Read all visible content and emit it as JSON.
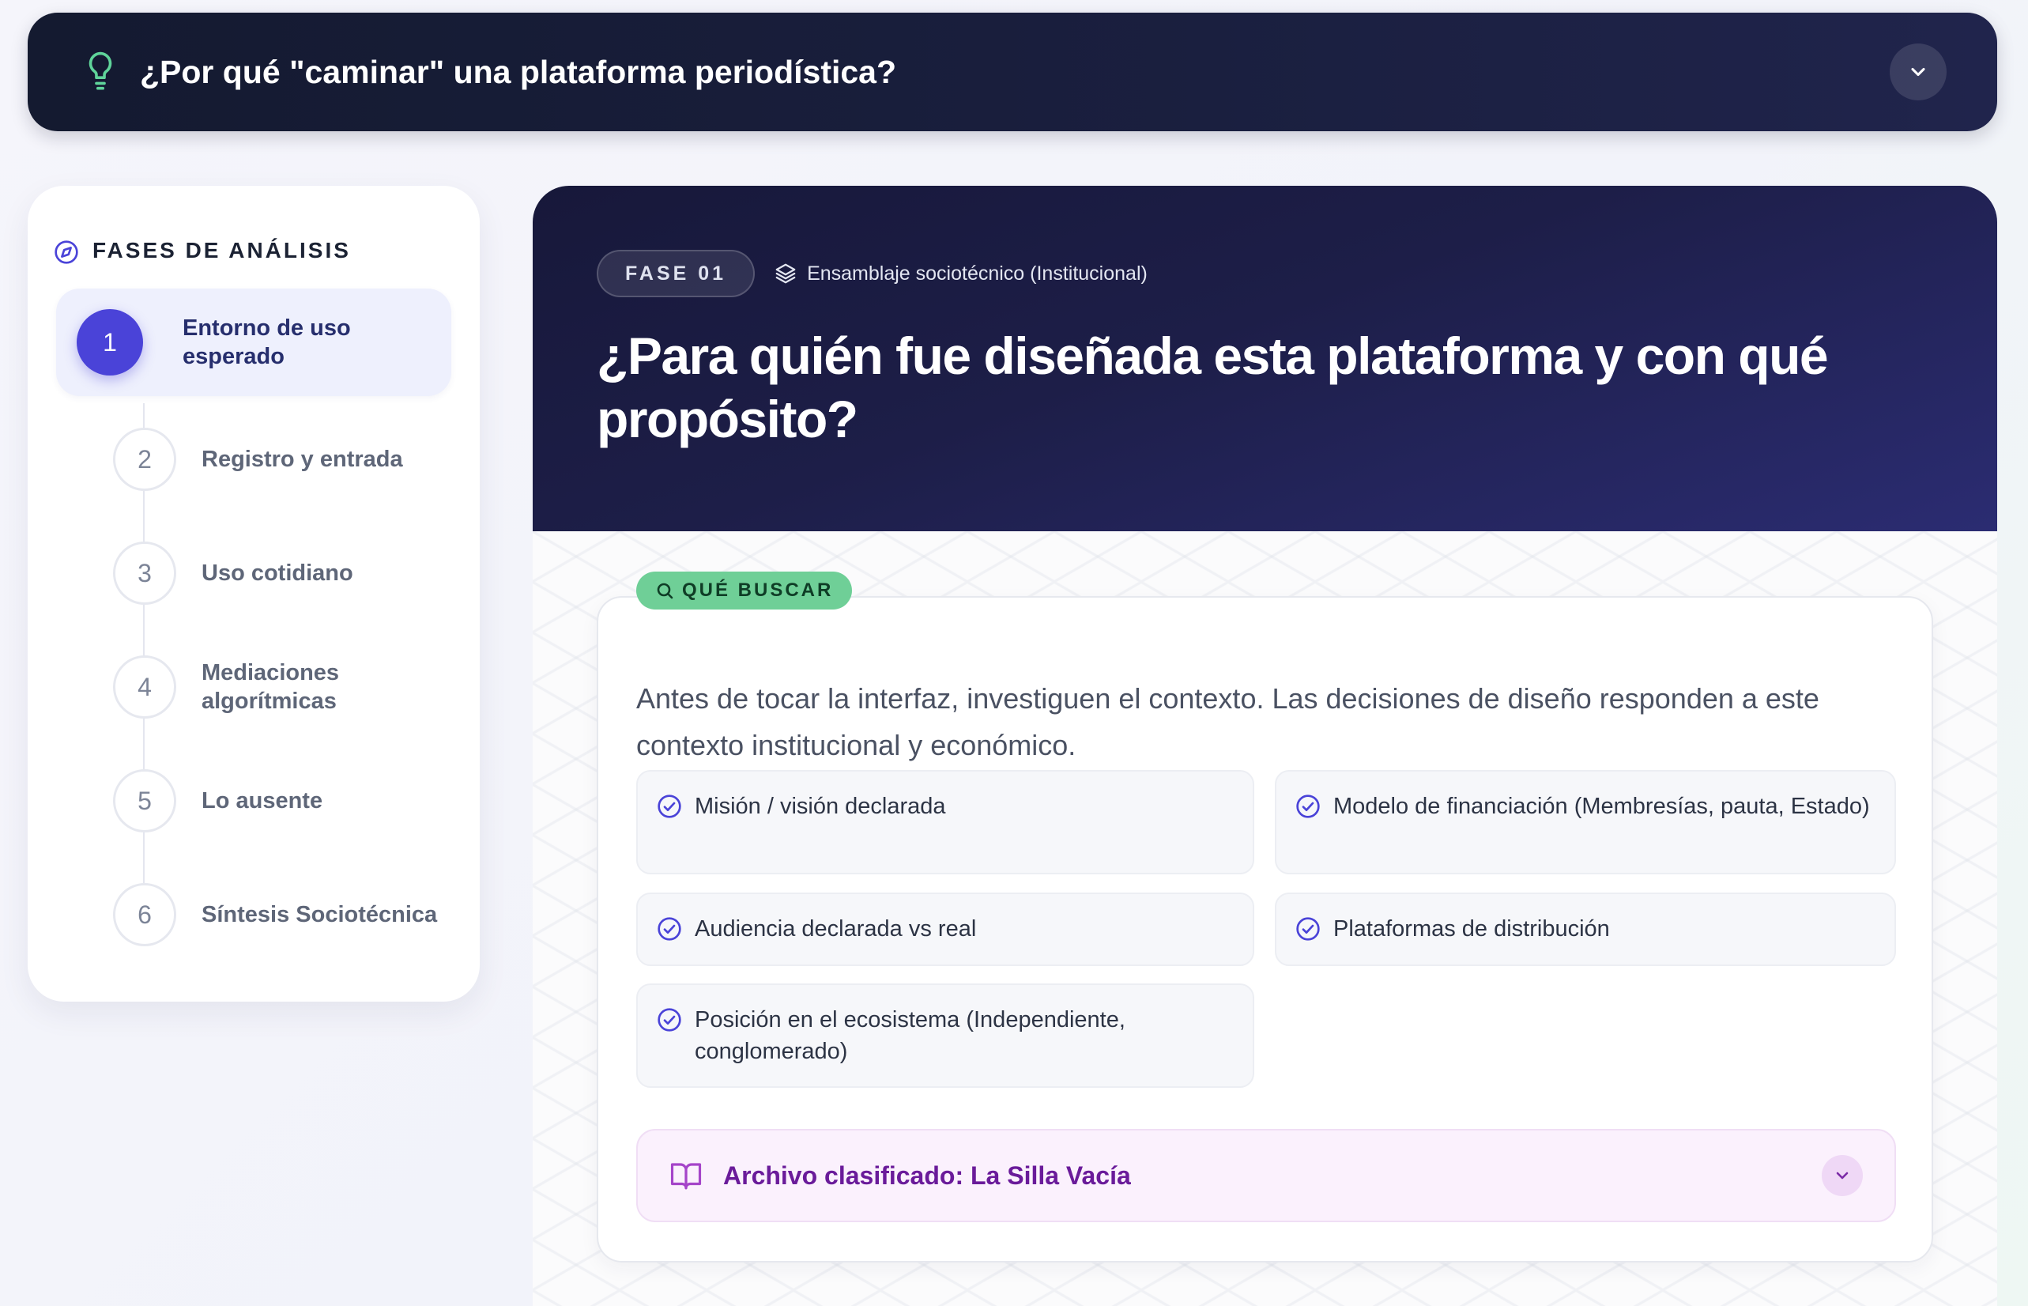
{
  "banner": {
    "icon": "lightbulb-icon",
    "title": "¿Por qué \"caminar\" una plataforma periodística?",
    "toggle_icon": "chevron-down-icon"
  },
  "sidebar": {
    "icon": "compass-icon",
    "title": "FASES DE ANÁLISIS",
    "active_index": 0,
    "steps": [
      {
        "number": "1",
        "label": "Entorno de uso esperado"
      },
      {
        "number": "2",
        "label": "Registro y entrada"
      },
      {
        "number": "3",
        "label": "Uso cotidiano"
      },
      {
        "number": "4",
        "label": "Mediaciones algorítmicas"
      },
      {
        "number": "5",
        "label": "Lo ausente"
      },
      {
        "number": "6",
        "label": "Síntesis Sociotécnica"
      }
    ]
  },
  "phase": {
    "badge": "FASE 01",
    "tag_icon": "layers-icon",
    "tag": "Ensamblaje sociotécnico (Institucional)",
    "title": "¿Para quién fue diseñada esta plataforma y con qué propósito?"
  },
  "look": {
    "badge_icon": "search-icon",
    "badge": "QUÉ BUSCAR",
    "intro": "Antes de tocar la interfaz, investiguen el contexto. Las decisiones de diseño responden a este contexto institucional y económico.",
    "items": [
      "Misión / visión declarada",
      "Modelo de financiación (Membresías, pauta, Estado)",
      "Audiencia declarada vs real",
      "Plataformas de distribución",
      "Posición en el ecosistema (Independiente, conglomerado)"
    ],
    "archive": {
      "icon": "book-open-icon",
      "title": "Archivo clasificado: La Silla Vacía",
      "toggle_icon": "chevron-down-icon"
    }
  },
  "colors": {
    "banner_bg": "#141a30",
    "accent_indigo": "#4a43d8",
    "hero_bg": "#1d1e48",
    "badge_green": "#6fcf97",
    "archive_purple": "#6a1b9a",
    "bulb_green": "#5fd49a"
  }
}
